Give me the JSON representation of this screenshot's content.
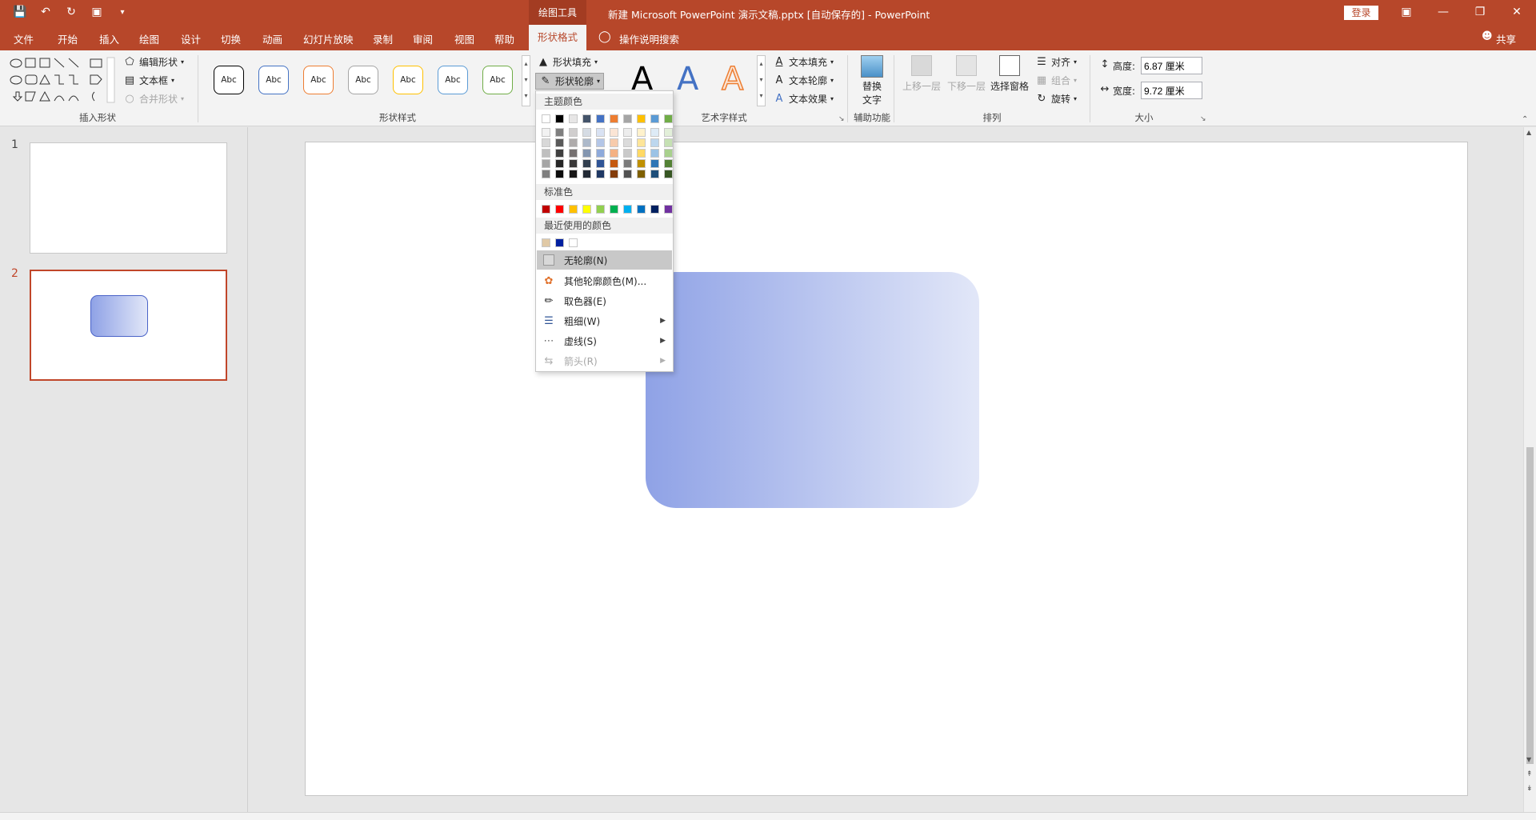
{
  "titlebar": {
    "context_tools_label": "绘图工具",
    "doc_title": "新建 Microsoft PowerPoint 演示文稿.pptx [自动保存的]  -  PowerPoint",
    "login_label": "登录"
  },
  "tabs": {
    "items": [
      "文件",
      "开始",
      "插入",
      "绘图",
      "设计",
      "切换",
      "动画",
      "幻灯片放映",
      "录制",
      "审阅",
      "视图",
      "帮助"
    ],
    "active": "形状格式",
    "tell_me": "操作说明搜索",
    "share": "共享"
  },
  "ribbon": {
    "insert_shapes": {
      "edit_shape": "编辑形状",
      "text_box": "文本框",
      "merge_shapes": "合并形状",
      "label": "插入形状"
    },
    "shape_styles": {
      "style_text": "Abc",
      "style_colors": [
        "#000000",
        "#4472c4",
        "#ed7d31",
        "#a5a5a5",
        "#ffc000",
        "#5b9bd5",
        "#70ad47"
      ],
      "shape_fill": "形状填充",
      "shape_outline": "形状轮廓",
      "label": "形状样式"
    },
    "wordart": {
      "letter": "A",
      "text_fill": "文本填充",
      "text_outline": "文本轮廓",
      "text_effects": "文本效果",
      "label": "艺术字样式"
    },
    "accessibility": {
      "alt_text_line1": "替换",
      "alt_text_line2": "文字",
      "label": "辅助功能"
    },
    "arrange": {
      "bring_forward": "上移一层",
      "send_backward": "下移一层",
      "selection_pane": "选择窗格",
      "align": "对齐",
      "group": "组合",
      "rotate": "旋转",
      "label": "排列"
    },
    "size": {
      "height_label": "高度:",
      "height_value": "6.87 厘米",
      "width_label": "宽度:",
      "width_value": "9.72 厘米",
      "label": "大小"
    }
  },
  "thumbnails": [
    {
      "number": "1"
    },
    {
      "number": "2"
    }
  ],
  "outline_menu": {
    "theme_colors_label": "主题颜色",
    "theme_top_row": [
      "#ffffff",
      "#000000",
      "#e7e6e6",
      "#44546a",
      "#4472c4",
      "#ed7d31",
      "#a5a5a5",
      "#ffc000",
      "#5b9bd5",
      "#70ad47"
    ],
    "theme_shades": [
      [
        "#f2f2f2",
        "#7f7f7f",
        "#d0cece",
        "#d6dce4",
        "#d9e2f3",
        "#fbe5d5",
        "#ededed",
        "#fff2cc",
        "#deebf6",
        "#e2efd9"
      ],
      [
        "#d8d8d8",
        "#595959",
        "#aeabab",
        "#adb9ca",
        "#b4c6e7",
        "#f7cbac",
        "#dbdbdb",
        "#fee599",
        "#bdd7ee",
        "#c5e0b3"
      ],
      [
        "#bfbfbf",
        "#3f3f3f",
        "#757070",
        "#8496b0",
        "#8eaadb",
        "#f4b183",
        "#c9c9c9",
        "#ffd965",
        "#9cc3e5",
        "#a8d08d"
      ],
      [
        "#a5a5a5",
        "#262626",
        "#3a3838",
        "#323f4f",
        "#2f5496",
        "#c55a11",
        "#7b7b7b",
        "#bf9000",
        "#2e75b5",
        "#538135"
      ],
      [
        "#7f7f7f",
        "#0c0c0c",
        "#171616",
        "#222a35",
        "#1f3864",
        "#833c0b",
        "#525252",
        "#7f6000",
        "#1e4e79",
        "#375623"
      ]
    ],
    "standard_colors_label": "标准色",
    "standard_colors": [
      "#c00000",
      "#ff0000",
      "#ffc000",
      "#ffff00",
      "#92d050",
      "#00b050",
      "#00b0f0",
      "#0070c0",
      "#002060",
      "#7030a0"
    ],
    "recent_colors_label": "最近使用的颜色",
    "recent_colors": [
      "#e0c9a6",
      "#0020a0",
      "#ffffff"
    ],
    "items": {
      "no_outline": "无轮廓(N)",
      "more_colors": "其他轮廓颜色(M)...",
      "eyedropper": "取色器(E)",
      "weight": "粗细(W)",
      "dashes": "虚线(S)",
      "arrows": "箭头(R)"
    }
  },
  "shape": {
    "gradient_start": "#8fa2e6",
    "gradient_end": "#e2e7f8"
  }
}
